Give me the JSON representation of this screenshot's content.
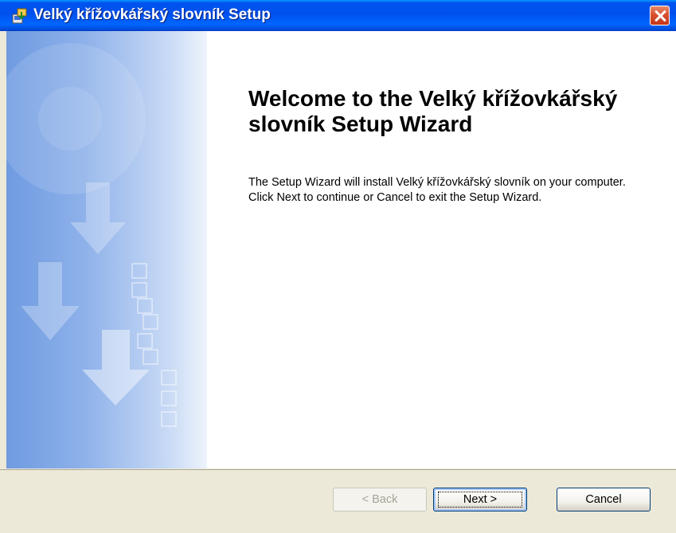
{
  "window": {
    "title": "Velký křížovkářský slovník Setup",
    "icon": "setup-installer-icon",
    "close_icon": "close-icon"
  },
  "welcome": {
    "title": "Welcome to the Velký křížovkářský slovník Setup Wizard",
    "description": "The Setup Wizard will install Velký křížovkářský slovník on your computer.  Click Next to continue or Cancel to exit the Setup Wizard."
  },
  "buttons": {
    "back": "< Back",
    "next": "Next >",
    "cancel": "Cancel"
  },
  "colors": {
    "titlebar": "#0053ee",
    "close_button": "#d9512d",
    "side_panel": "#8fb2ea",
    "footer": "#ece9d8"
  }
}
